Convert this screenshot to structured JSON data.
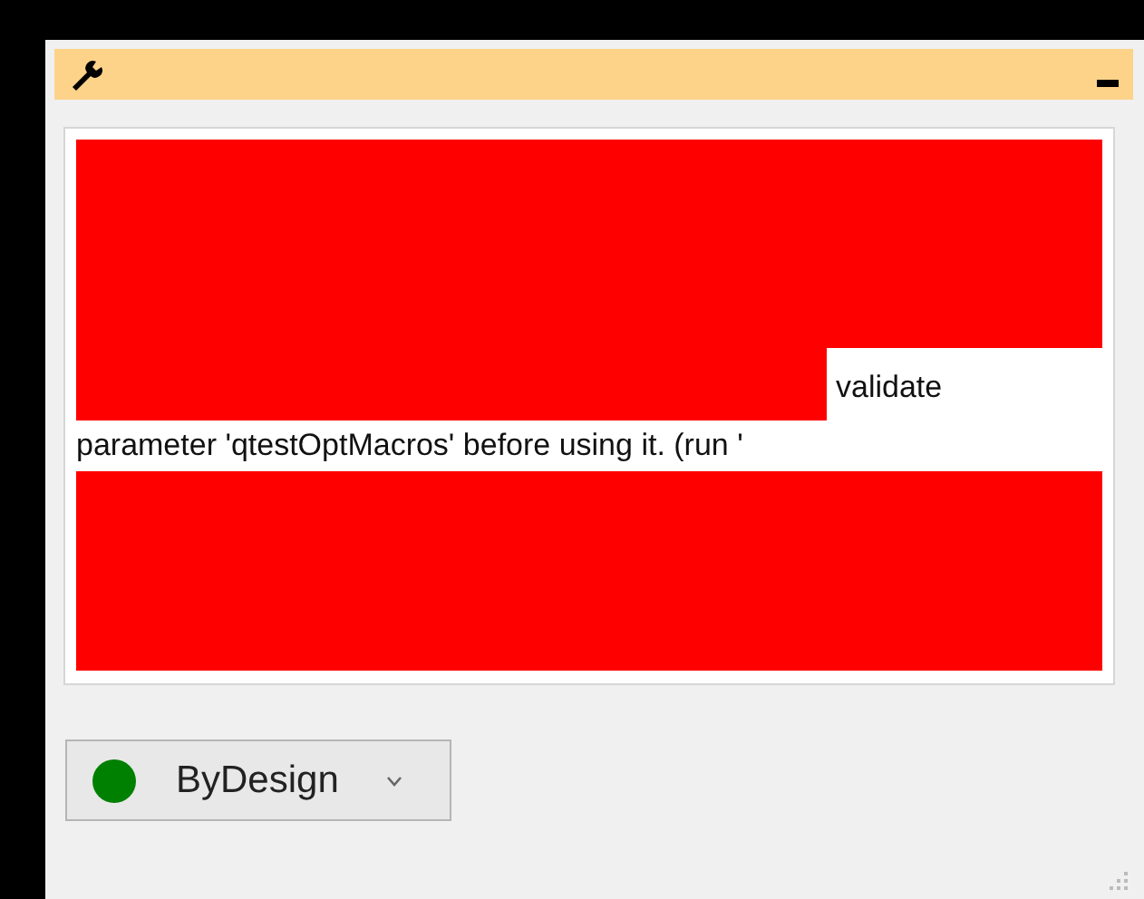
{
  "message": {
    "lines": [
      "validate",
      "parameter 'qtestOptMacros' before using it. (run '"
    ]
  },
  "status_dropdown": {
    "value": "ByDesign",
    "color": "#008000"
  }
}
